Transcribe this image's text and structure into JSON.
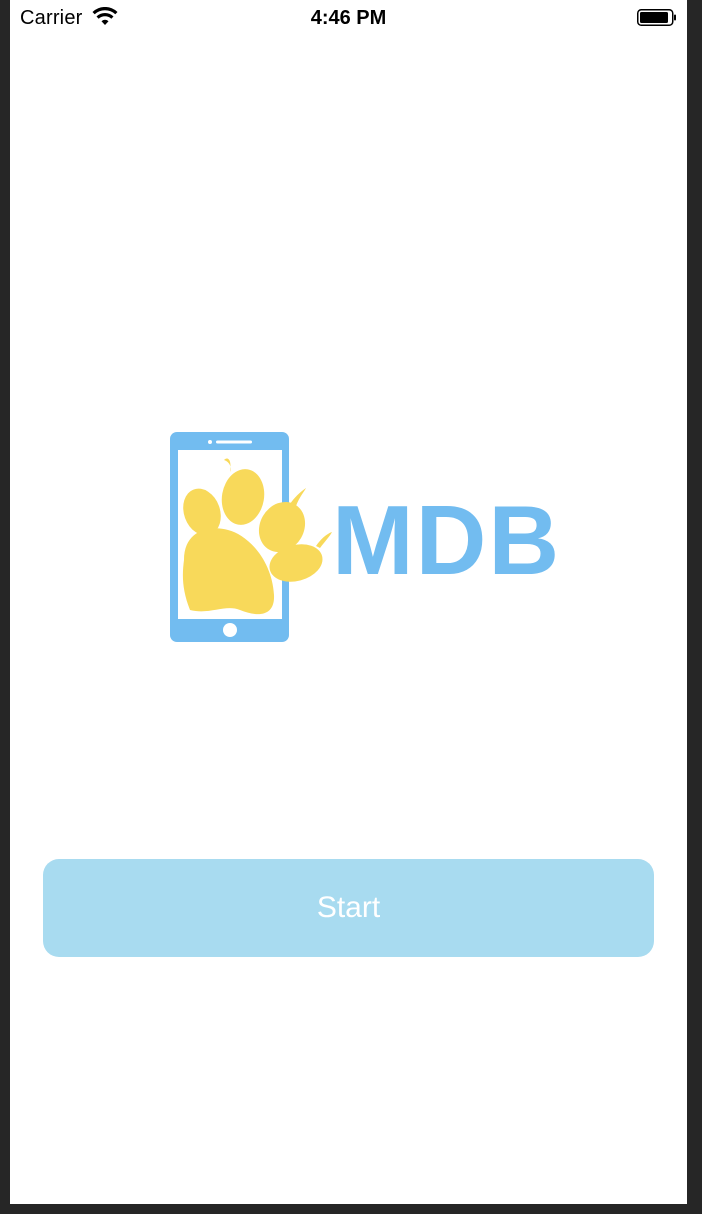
{
  "status_bar": {
    "carrier": "Carrier",
    "time": "4:46 PM",
    "wifi_icon": "wifi-icon",
    "battery_icon": "battery-icon"
  },
  "logo": {
    "text": "MDB",
    "icon": "phone-paw-icon",
    "colors": {
      "phone": "#72bcf0",
      "paw": "#f8d95a"
    }
  },
  "start_button": {
    "label": "Start",
    "background": "#a8dbf0"
  }
}
